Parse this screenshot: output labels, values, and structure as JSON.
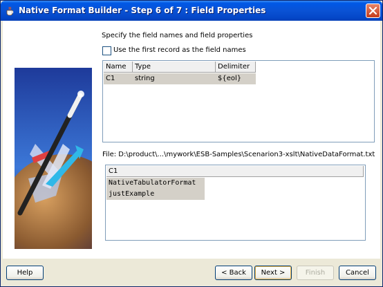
{
  "window": {
    "title": "Native Format Builder - Step 6 of 7 : Field Properties"
  },
  "main": {
    "instruction": "Specify the field names and field properties",
    "use_first_record_label": "Use the first record as the field names",
    "use_first_record_checked": false,
    "fields_table": {
      "columns": [
        "Name",
        "Type",
        "Delimiter"
      ],
      "rows": [
        {
          "name": "C1",
          "type": "string",
          "delimiter": "${eol}"
        }
      ]
    },
    "file_label": "File: D:\\product\\...\\mywork\\ESB-Samples\\Scenarion3-xslt\\NativeDataFormat.txt",
    "preview": {
      "column": "C1",
      "rows": [
        "NativeTabulatorFormat",
        "justExample"
      ]
    }
  },
  "buttons": {
    "help": "Help",
    "back": "< Back",
    "next": "Next >",
    "finish": "Finish",
    "cancel": "Cancel"
  }
}
